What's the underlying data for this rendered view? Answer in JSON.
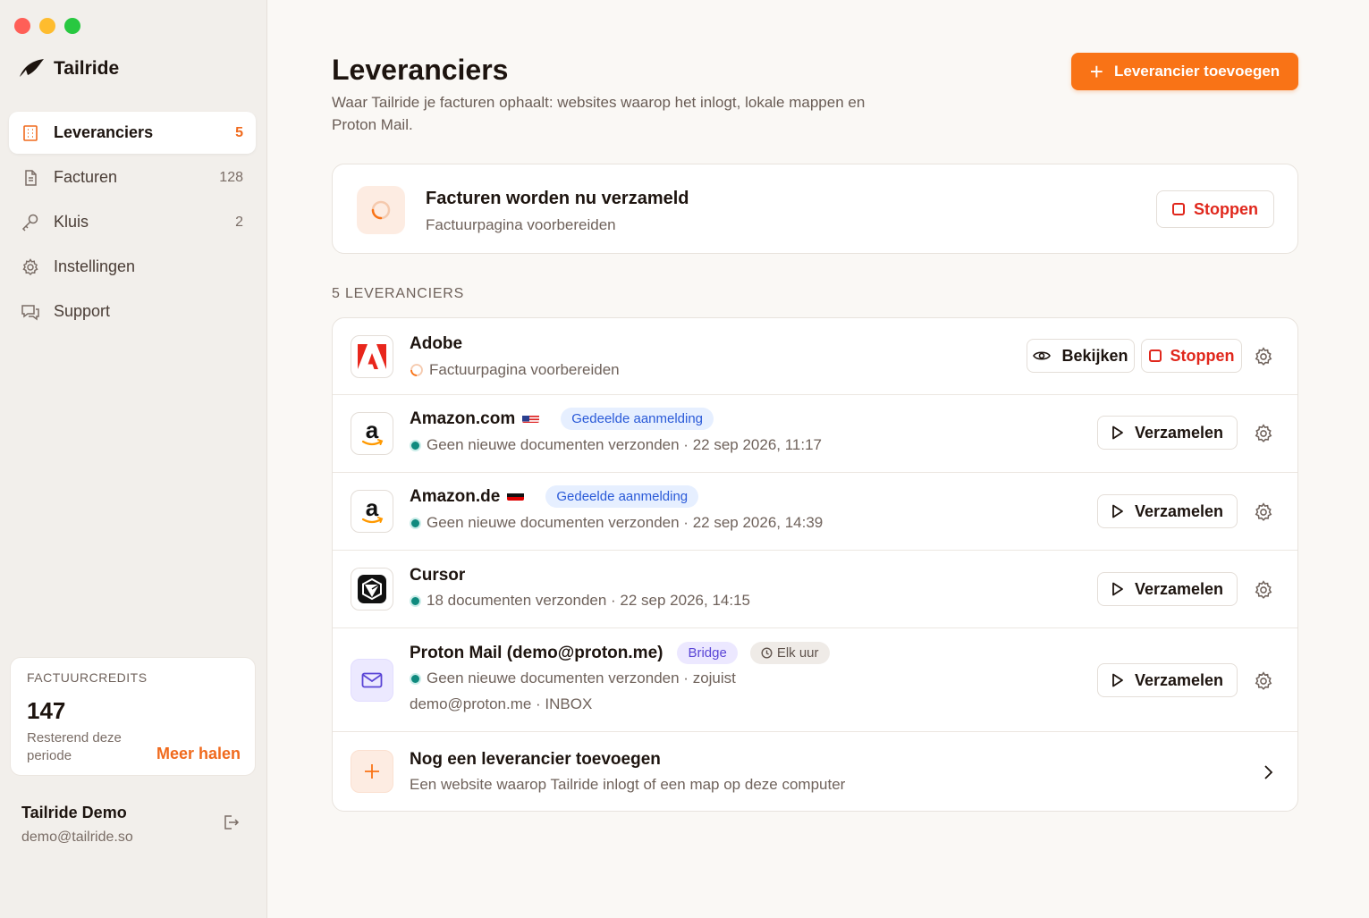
{
  "sidebar": {
    "brand": "Tailride",
    "items": [
      {
        "label": "Leveranciers",
        "count": "5",
        "icon": "building-icon"
      },
      {
        "label": "Facturen",
        "count": "128",
        "icon": "document-icon"
      },
      {
        "label": "Kluis",
        "count": "2",
        "icon": "key-icon"
      },
      {
        "label": "Instellingen",
        "count": "",
        "icon": "gear-icon"
      },
      {
        "label": "Support",
        "count": "",
        "icon": "chat-icon"
      }
    ],
    "credits": {
      "caption": "FACTUURCREDITS",
      "value": "147",
      "remaining_label": "Resterend deze periode",
      "more_label": "Meer halen"
    },
    "user": {
      "name": "Tailride Demo",
      "email": "demo@tailride.so"
    }
  },
  "header": {
    "title": "Leveranciers",
    "subtitle": "Waar Tailride je facturen ophaalt: websites waarop het inlogt, lokale mappen en Proton Mail.",
    "add_button": "Leverancier toevoegen"
  },
  "status_card": {
    "title": "Facturen worden nu verzameld",
    "subtitle": "Factuurpagina voorbereiden",
    "stop_label": "Stoppen"
  },
  "section_caption": "5 LEVERANCIERS",
  "vendors": [
    {
      "name": "Adobe",
      "status": "Factuurpagina voorbereiden",
      "view_label": "Bekijken",
      "stop_label": "Stoppen"
    },
    {
      "name": "Amazon.com",
      "badge": "Gedeelde aanmelding",
      "status": "Geen nieuwe documenten verzonden · 22 sep 2026, 11:17",
      "action_label": "Verzamelen"
    },
    {
      "name": "Amazon.de",
      "badge": "Gedeelde aanmelding",
      "status": "Geen nieuwe documenten verzonden · 22 sep 2026, 14:39",
      "action_label": "Verzamelen"
    },
    {
      "name": "Cursor",
      "status": "18 documenten verzonden · 22 sep 2026, 14:15",
      "action_label": "Verzamelen"
    },
    {
      "name": "Proton Mail (demo@proton.me)",
      "badge": "Bridge",
      "schedule": "Elk uur",
      "status": "Geen nieuwe documenten verzonden · zojuist",
      "detail": "demo@proton.me · INBOX",
      "action_label": "Verzamelen"
    }
  ],
  "add_row": {
    "title": "Nog een leverancier toevoegen",
    "subtitle": "Een website waarop Tailride inlogt of een map op deze computer"
  },
  "colors": {
    "accent": "#f97316",
    "stop": "#e0271c",
    "success_dot": "#0f8a7e",
    "badge_blue": "#2a5ad8",
    "badge_purple": "#5a45d6"
  }
}
